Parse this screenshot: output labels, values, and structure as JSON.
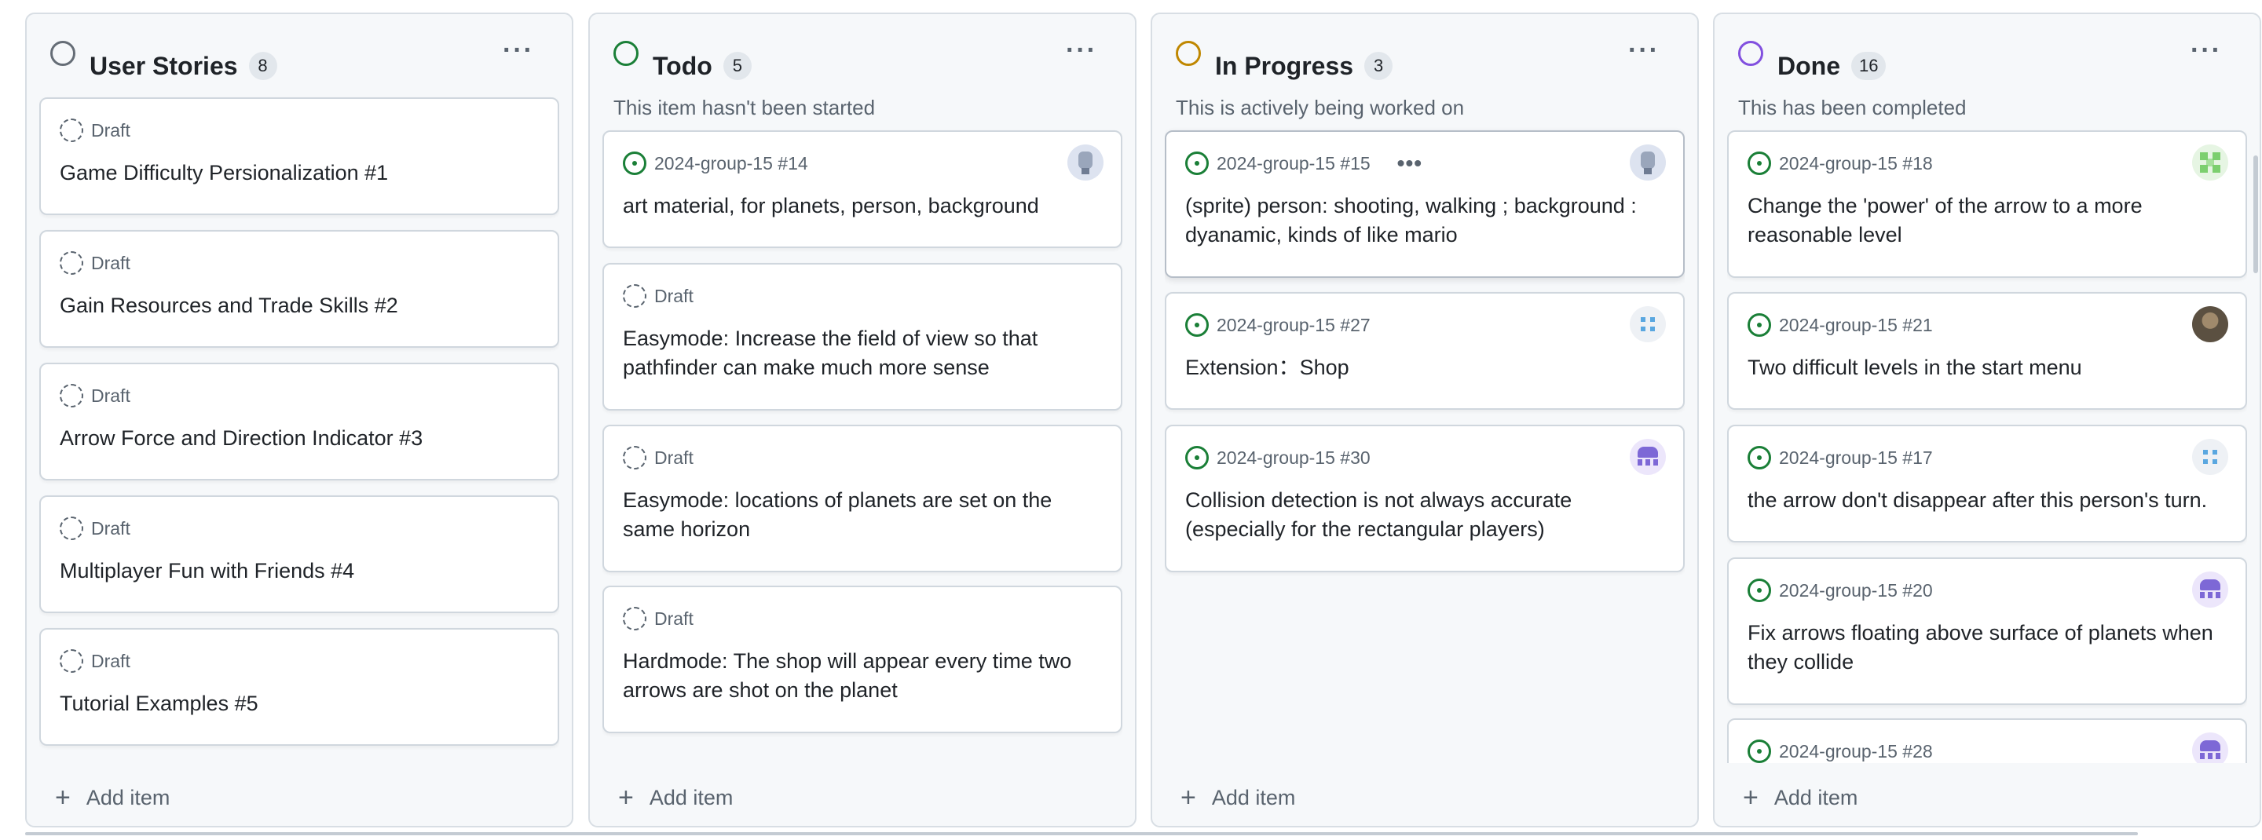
{
  "board": {
    "add_item_label": "Add item",
    "columns": [
      {
        "title": "User Stories",
        "count": "8",
        "description": "",
        "status_color": "#656d76",
        "cards": [
          {
            "type": "draft",
            "meta": "Draft",
            "title": "Game Difficulty Persionalization #1"
          },
          {
            "type": "draft",
            "meta": "Draft",
            "title": "Gain Resources and Trade Skills #2"
          },
          {
            "type": "draft",
            "meta": "Draft",
            "title": "Arrow Force and Direction Indicator #3"
          },
          {
            "type": "draft",
            "meta": "Draft",
            "title": "Multiplayer Fun with Friends #4"
          },
          {
            "type": "draft",
            "meta": "Draft",
            "title": "Tutorial Examples #5"
          }
        ]
      },
      {
        "title": "Todo",
        "count": "5",
        "description": "This item hasn't been started",
        "status_color": "#1a7f37",
        "cards": [
          {
            "type": "issue",
            "meta": "2024-group-15 #14",
            "title": "art material, for planets, person, background",
            "avatar": "robot-avatar"
          },
          {
            "type": "draft",
            "meta": "Draft",
            "title": "Easymode: Increase the field of view so that pathfinder can make much more sense"
          },
          {
            "type": "draft",
            "meta": "Draft",
            "title": "Easymode: locations of planets are set on the same horizon"
          },
          {
            "type": "draft",
            "meta": "Draft",
            "title": "Hardmode: The shop will appear every time two arrows are shot on the planet"
          }
        ]
      },
      {
        "title": "In Progress",
        "count": "3",
        "description": "This is actively being worked on",
        "status_color": "#bf8700",
        "cards": [
          {
            "type": "issue",
            "meta": "2024-group-15 #15",
            "title": "(sprite) person: shooting, walking ; background : dyanamic, kinds of like mario",
            "avatar": "robot-avatar",
            "has_menu": true
          },
          {
            "type": "issue",
            "meta": "2024-group-15 #27",
            "title": "Extension：Shop",
            "avatar": "dots-avatar"
          },
          {
            "type": "issue",
            "meta": "2024-group-15 #30",
            "title": "Collision detection is not always accurate (especially for the rectangular players)",
            "avatar": "invader-avatar"
          }
        ]
      },
      {
        "title": "Done",
        "count": "16",
        "description": "This has been completed",
        "status_color": "#8250df",
        "cards": [
          {
            "type": "issue",
            "meta": "2024-group-15 #18",
            "title": "Change the 'power' of the arrow to a more reasonable level",
            "avatar": "green-avatar"
          },
          {
            "type": "issue",
            "meta": "2024-group-15 #21",
            "title": "Two difficult levels in the start menu",
            "avatar": "photo-avatar"
          },
          {
            "type": "issue",
            "meta": "2024-group-15 #17",
            "title": "the arrow don't disappear after this person's turn.",
            "avatar": "dots-avatar"
          },
          {
            "type": "issue",
            "meta": "2024-group-15 #20",
            "title": "Fix arrows floating above surface of planets when they collide",
            "avatar": "invader-avatar"
          },
          {
            "type": "issue",
            "meta": "2024-group-15 #28",
            "title": "",
            "avatar": "invader-avatar"
          }
        ]
      }
    ]
  }
}
